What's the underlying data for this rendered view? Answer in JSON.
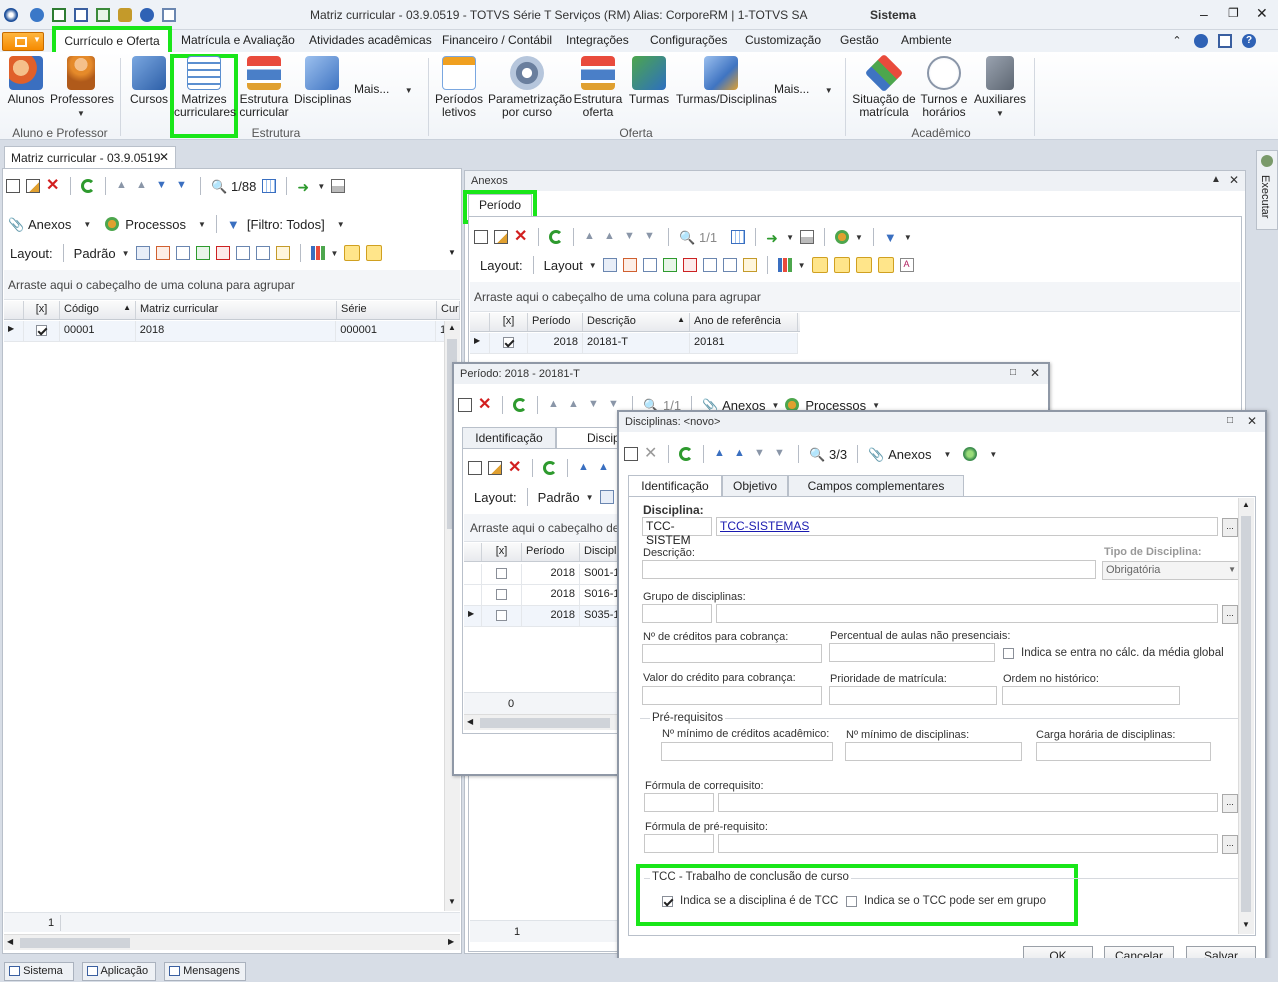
{
  "window": {
    "title": "Matriz curricular - 03.9.0519 - TOTVS Série T Serviços (RM) Alias: CorporeRM | 1-TOTVS SA",
    "section": "Sistema"
  },
  "ribbon": {
    "tabs": [
      "Currículo e Oferta",
      "Matrícula e Avaliação",
      "Atividades acadêmicas",
      "Financeiro / Contábil",
      "Integrações",
      "Configurações",
      "Customização",
      "Gestão",
      "Ambiente"
    ],
    "buttons": {
      "alunos": "Alunos",
      "professores": "Professores",
      "cursos": "Cursos",
      "matrizes": [
        "Matrizes",
        "curriculares"
      ],
      "estrutura": [
        "Estrutura",
        "curricular"
      ],
      "disciplinas": "Disciplinas",
      "mais1": "Mais...",
      "periodos": [
        "Períodos",
        "letivos"
      ],
      "parametrizacao": [
        "Parametrização",
        "por curso"
      ],
      "estrutura_oferta": [
        "Estrutura",
        "oferta"
      ],
      "turmas": "Turmas",
      "turmas_disc": "Turmas/Disciplinas",
      "mais2": "Mais...",
      "situacao": [
        "Situação de",
        "matrícula"
      ],
      "turnos": [
        "Turnos e",
        "horários"
      ],
      "auxiliares": "Auxiliares"
    },
    "groups": [
      "Aluno e Professor",
      "Estrutura curricular",
      "Oferta",
      "Acadêmico"
    ]
  },
  "doc_tab": "Matriz curricular - 03.9.0519",
  "main": {
    "record": "1/88",
    "anexos": "Anexos",
    "processos": "Processos",
    "filtro": "[Filtro: Todos]",
    "layout_label": "Layout:",
    "layout_value": "Padrão",
    "group_hint": "Arraste aqui o cabeçalho de uma coluna para agrupar",
    "columns": [
      "[x]",
      "Código",
      "Matriz curricular",
      "Série",
      "Curs"
    ],
    "rows": [
      [
        "00001",
        "2018",
        "000001",
        "1"
      ]
    ],
    "footer_count": "1"
  },
  "anexos_panel": {
    "title": "Anexos",
    "tab": "Período",
    "record": "1/1",
    "layout_label": "Layout:",
    "layout_value": "Layout",
    "group_hint": "Arraste aqui o cabeçalho de uma coluna para agrupar",
    "columns": [
      "[x]",
      "Período",
      "Descrição",
      "Ano de referência"
    ],
    "rows": [
      [
        "2018",
        "20181-T",
        "20181"
      ]
    ],
    "footer_count": "1"
  },
  "periodo_win": {
    "title": "Período: 2018 - 20181-T",
    "record": "1/1",
    "anexos": "Anexos",
    "processos": "Processos",
    "tabs": [
      "Identificação",
      "Discip"
    ],
    "layout_label": "Layout:",
    "layout_value": "Padrão",
    "group_hint": "Arraste aqui o cabeçalho de uma coluna para agrupar",
    "columns": [
      "[x]",
      "Período",
      "Discipli"
    ],
    "rows": [
      [
        "2018",
        "S001-1"
      ],
      [
        "2018",
        "S016-1"
      ],
      [
        "2018",
        "S035-1"
      ]
    ],
    "footer_count": "0"
  },
  "disc_win": {
    "title": "Disciplinas: <novo>",
    "record": "3/3",
    "anexos": "Anexos",
    "tabs": [
      "Identificação",
      "Objetivo",
      "Campos complementares"
    ],
    "disciplina_label": "Disciplina:",
    "disciplina_code": "TCC-SISTEM",
    "disciplina_link": "TCC-SISTEMAS",
    "descricao_label": "Descrição:",
    "tipo_label": "Tipo de Disciplina:",
    "tipo_value": "Obrigatória",
    "grupo_label": "Grupo de disciplinas:",
    "creditos_label": "Nº de créditos para cobrança:",
    "percentual_label": "Percentual de aulas não presenciais:",
    "indica_media_label": "Indica se entra no cálc. da média global",
    "valor_credito_label": "Valor do crédito para cobrança:",
    "prioridade_label": "Prioridade de matrícula:",
    "ordem_label": "Ordem no histórico:",
    "prereq_group": "Pré-requisitos",
    "min_creditos_label": "Nº mínimo de créditos acadêmico:",
    "min_disc_label": "Nº mínimo de disciplinas:",
    "carga_label": "Carga horária de disciplinas:",
    "formula_coreq_label": "Fórmula de correquisito:",
    "formula_prereq_label": "Fórmula de pré-requisito:",
    "tcc_group": "TCC - Trabalho de conclusão de curso",
    "tcc_check1": "Indica se a disciplina é de TCC",
    "tcc_check2": "Indica se o TCC pode ser em grupo",
    "ok": "OK",
    "cancelar": "Cancelar",
    "salvar": "Salvar"
  },
  "side": {
    "executar": "Executar"
  },
  "status": {
    "sistema": "Sistema",
    "aplicacao": "Aplicação",
    "mensagens": "Mensagens"
  }
}
